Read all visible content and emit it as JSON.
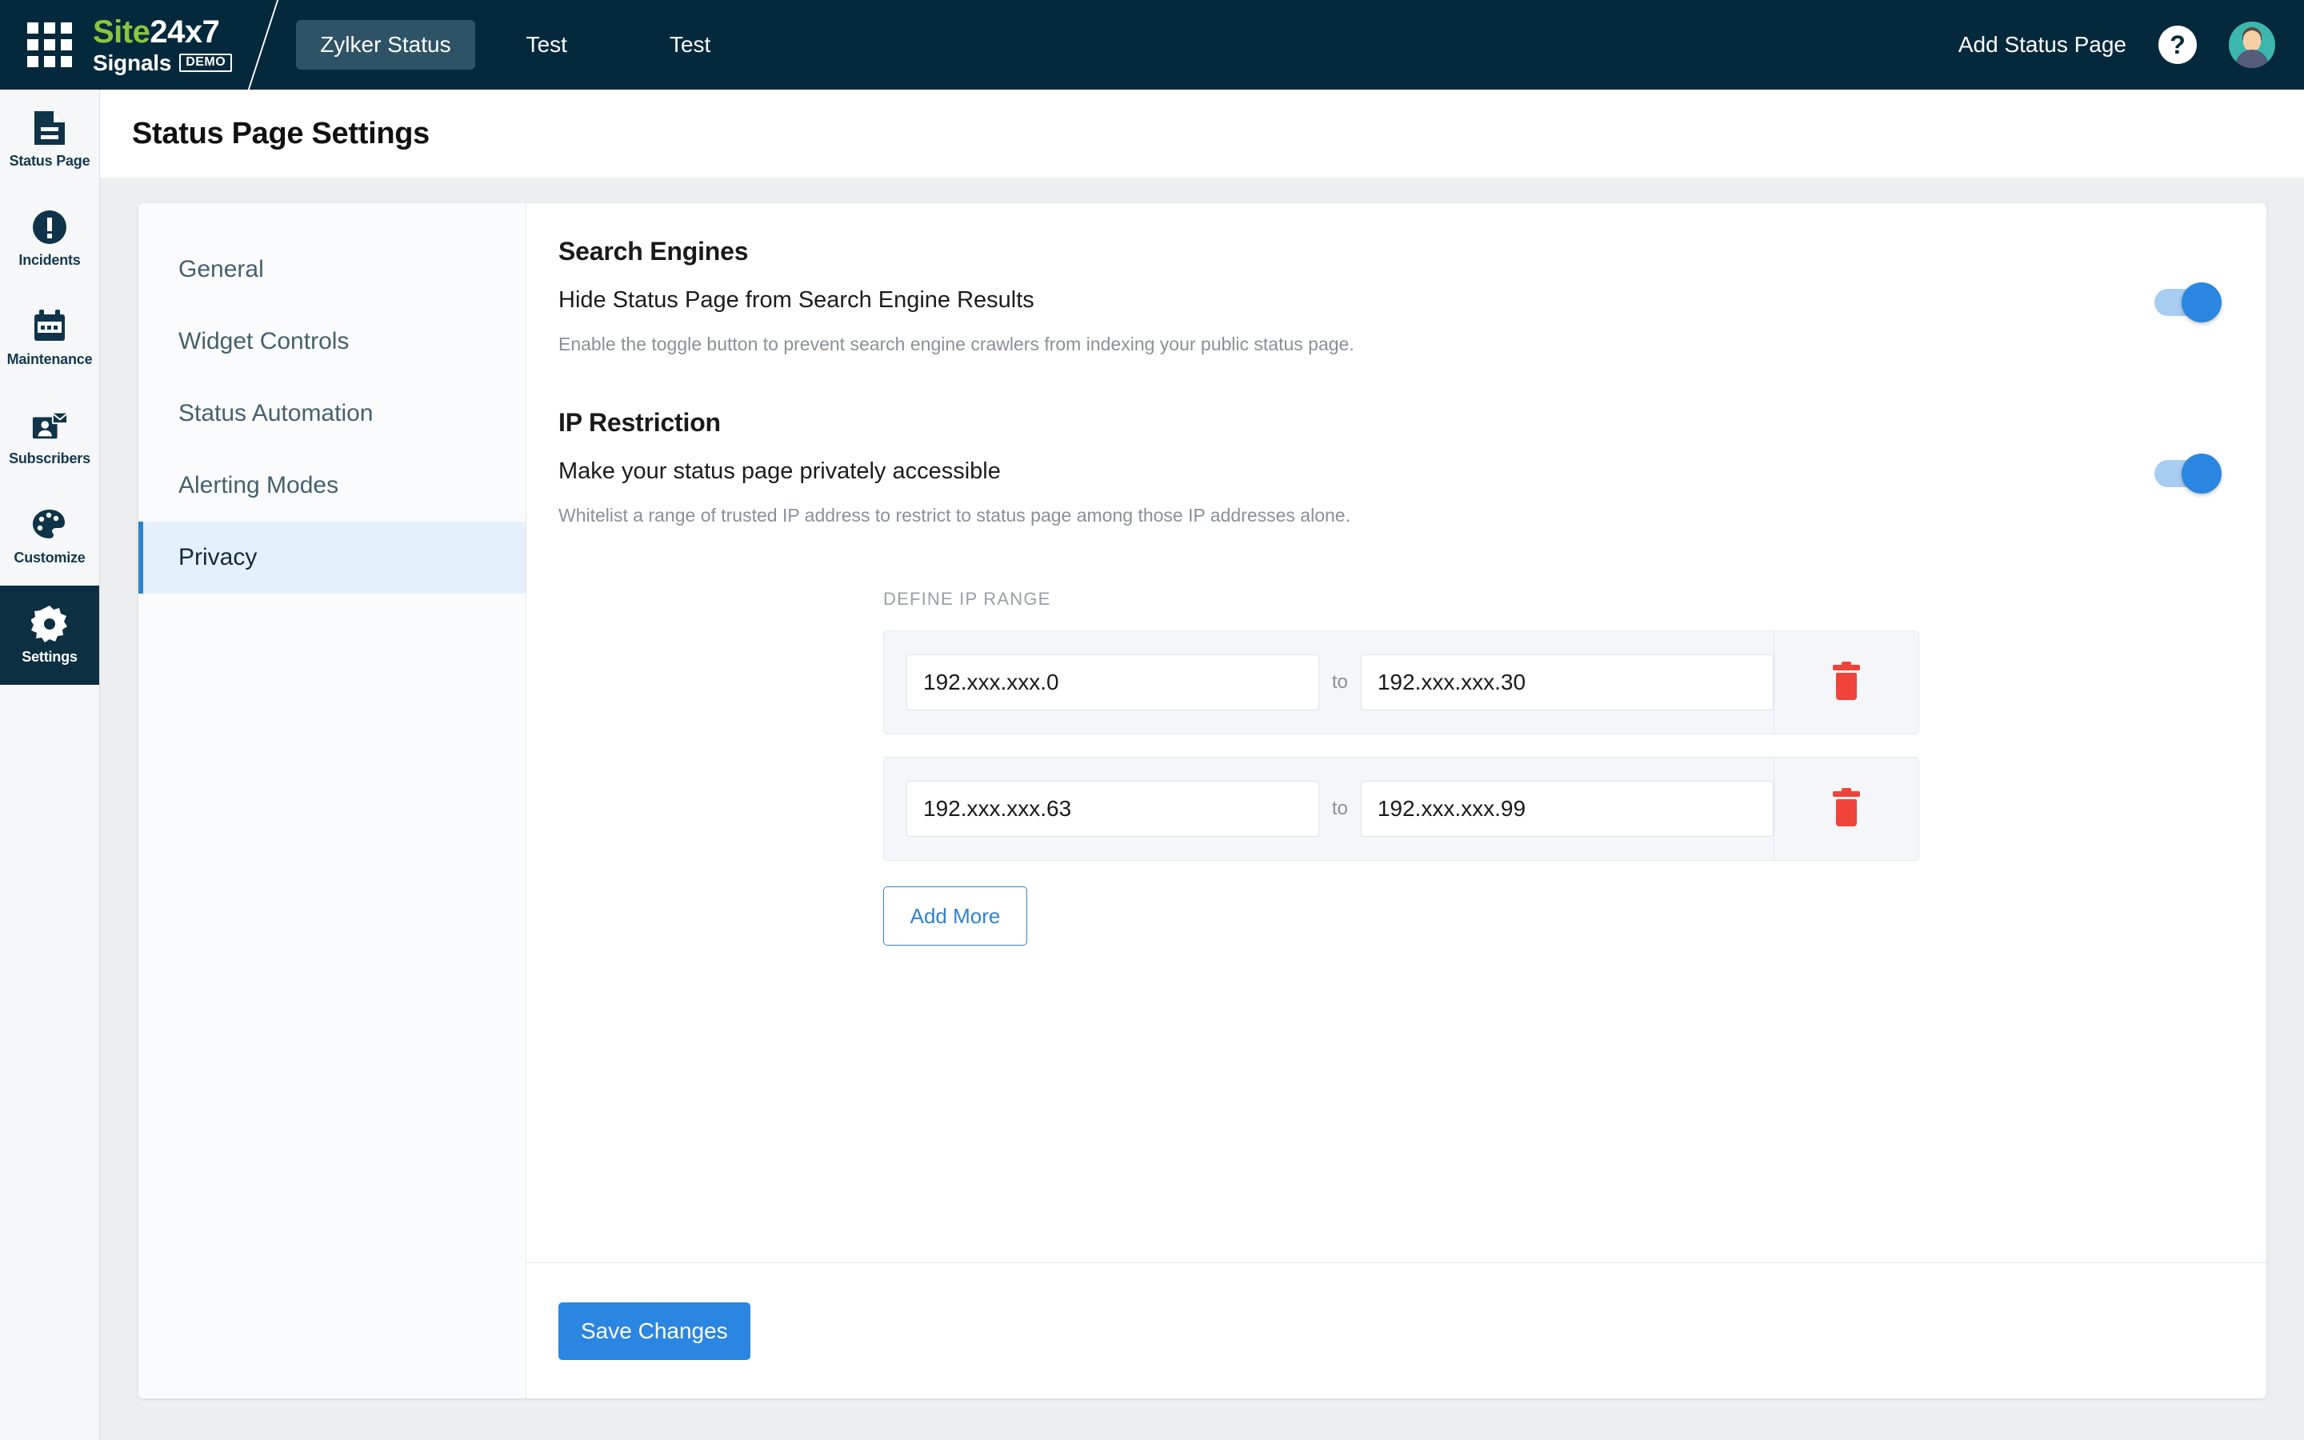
{
  "topbar": {
    "apps_icon": "grid-apps-icon",
    "brand": {
      "site": "Site",
      "num": "24x7",
      "signals": "Signals",
      "demo": "DEMO"
    },
    "tabs": [
      {
        "label": "Zylker Status",
        "active": true
      },
      {
        "label": "Test",
        "active": false
      },
      {
        "label": "Test",
        "active": false
      }
    ],
    "add_status_page": "Add Status Page",
    "help_icon": "?",
    "avatar": "user-avatar"
  },
  "rail": {
    "items": [
      {
        "label": "Status Page",
        "icon": "document-icon",
        "active": false
      },
      {
        "label": "Incidents",
        "icon": "alert-circle-icon",
        "active": false
      },
      {
        "label": "Maintenance",
        "icon": "calendar-icon",
        "active": false
      },
      {
        "label": "Subscribers",
        "icon": "subscribers-icon",
        "active": false
      },
      {
        "label": "Customize",
        "icon": "palette-icon",
        "active": false
      },
      {
        "label": "Settings",
        "icon": "gear-icon",
        "active": true
      }
    ]
  },
  "page": {
    "title": "Status Page Settings"
  },
  "side_nav": {
    "items": [
      {
        "label": "General",
        "active": false
      },
      {
        "label": "Widget Controls",
        "active": false
      },
      {
        "label": "Status Automation",
        "active": false
      },
      {
        "label": "Alerting Modes",
        "active": false
      },
      {
        "label": "Privacy",
        "active": true
      }
    ]
  },
  "privacy": {
    "search_engines": {
      "heading": "Search Engines",
      "row_title": "Hide Status Page from Search Engine Results",
      "description": "Enable the toggle button to prevent search engine crawlers from indexing your public status page.",
      "toggle_on": true
    },
    "ip_restriction": {
      "heading": "IP Restriction",
      "row_title": "Make your status page privately accessible",
      "description": "Whitelist a range of trusted IP address to restrict to status page among those IP addresses alone.",
      "toggle_on": true,
      "define_label": "DEFINE IP RANGE",
      "to_label": "to",
      "rows": [
        {
          "from": "192.xxx.xxx.0",
          "to": "192.xxx.xxx.30",
          "delete_icon": "trash-icon"
        },
        {
          "from": "192.xxx.xxx.63",
          "to": "192.xxx.xxx.99",
          "delete_icon": "trash-icon"
        }
      ],
      "add_more_label": "Add More"
    }
  },
  "footer": {
    "save_label": "Save Changes"
  },
  "colors": {
    "topbar_bg": "#04293c",
    "accent_blue": "#2a86e0",
    "nav_active_bg": "#e4f1fd",
    "nav_active_border": "#3182ce",
    "brand_green": "#8bc53f",
    "danger_red": "#f0433a",
    "page_bg": "#eceef0"
  }
}
